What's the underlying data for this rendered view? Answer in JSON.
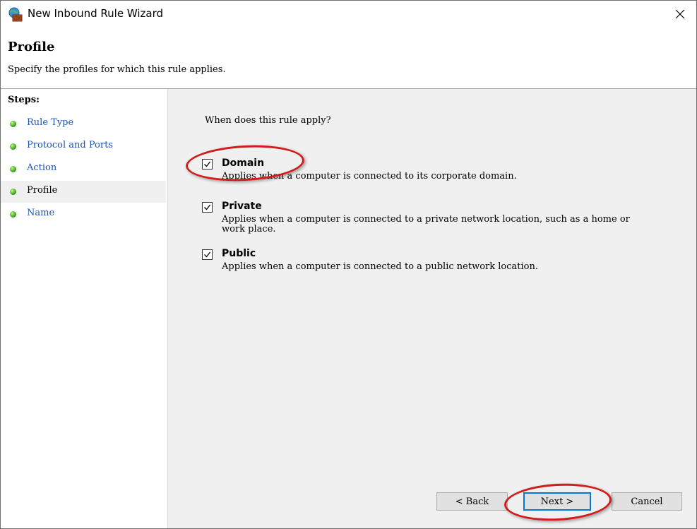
{
  "window": {
    "title": "New Inbound Rule Wizard",
    "icon": "firewall-globe-icon",
    "close_icon": "close-icon"
  },
  "header": {
    "title": "Profile",
    "subtitle": "Specify the profiles for which this rule applies."
  },
  "steps": {
    "title": "Steps:",
    "items": [
      {
        "label": "Rule Type",
        "active": false
      },
      {
        "label": "Protocol and Ports",
        "active": false
      },
      {
        "label": "Action",
        "active": false
      },
      {
        "label": "Profile",
        "active": true
      },
      {
        "label": "Name",
        "active": false
      }
    ]
  },
  "content": {
    "question": "When does this rule apply?",
    "options": [
      {
        "label": "Domain",
        "description": "Applies when a computer is connected to its corporate domain.",
        "checked": true
      },
      {
        "label": "Private",
        "description": "Applies when a computer is connected to a private network location, such as a home or work place.",
        "checked": true
      },
      {
        "label": "Public",
        "description": "Applies when a computer is connected to a public network location.",
        "checked": true
      }
    ]
  },
  "buttons": {
    "back": "< Back",
    "next": "Next >",
    "cancel": "Cancel"
  },
  "colors": {
    "step_link": "#1a55b5",
    "annotation": "#d11c1c",
    "content_bg": "#f0f0f0",
    "default_button_border": "#0078d7"
  }
}
